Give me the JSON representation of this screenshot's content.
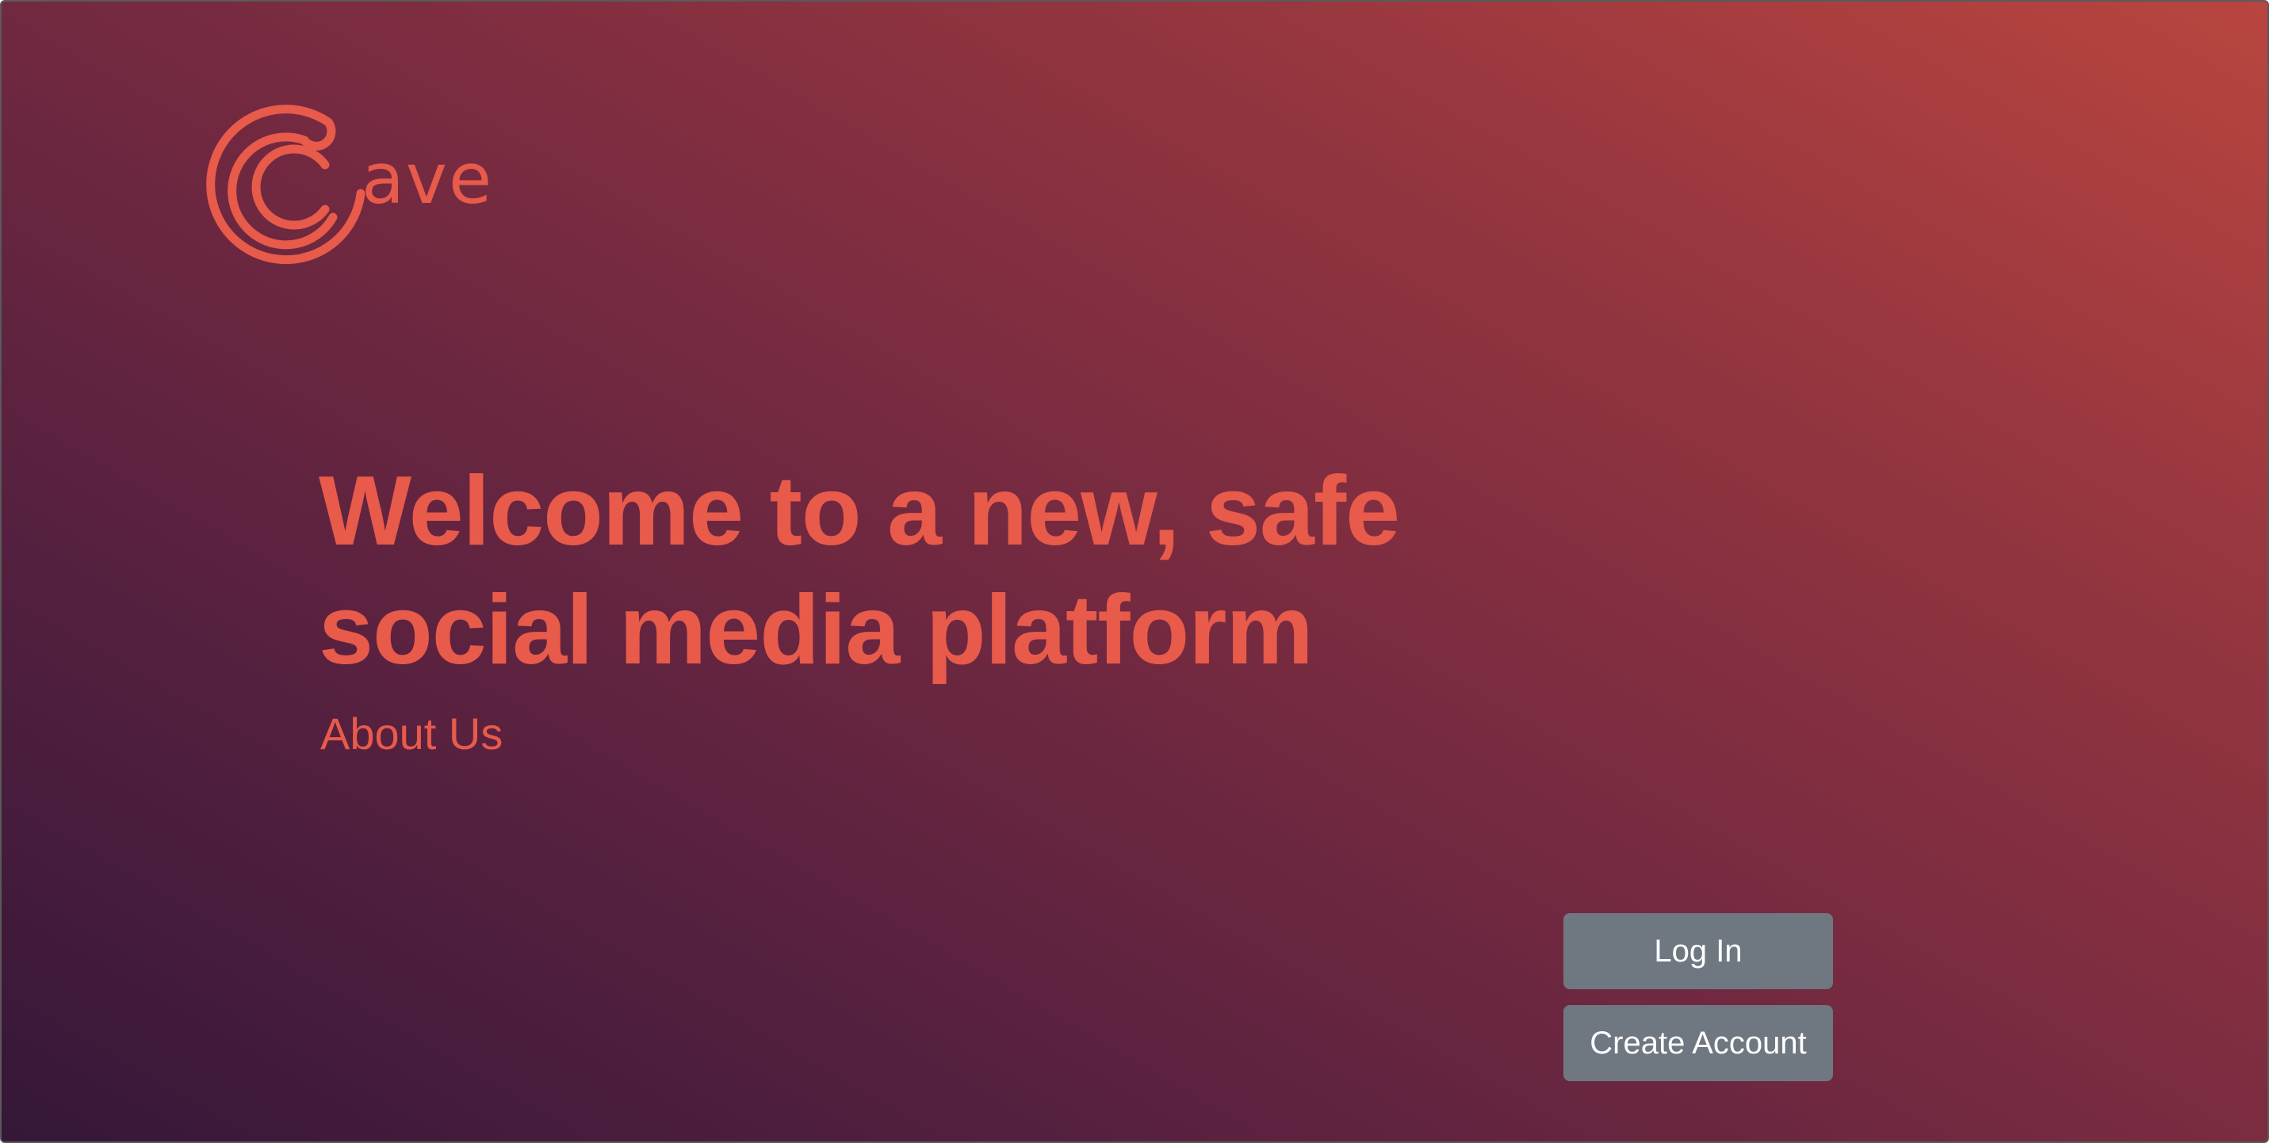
{
  "brand": {
    "wordmark": "ave",
    "logo_icon": "concentric-c-logo-icon",
    "accent_color": "#e85a4a"
  },
  "hero": {
    "headline": "Welcome to a new, safe social media platform",
    "about_link": "About Us"
  },
  "actions": {
    "login_label": "Log In",
    "create_account_label": "Create Account",
    "button_color": "#6f7781"
  },
  "background": {
    "gradient_start": "#351738",
    "gradient_end": "#b9453f"
  }
}
